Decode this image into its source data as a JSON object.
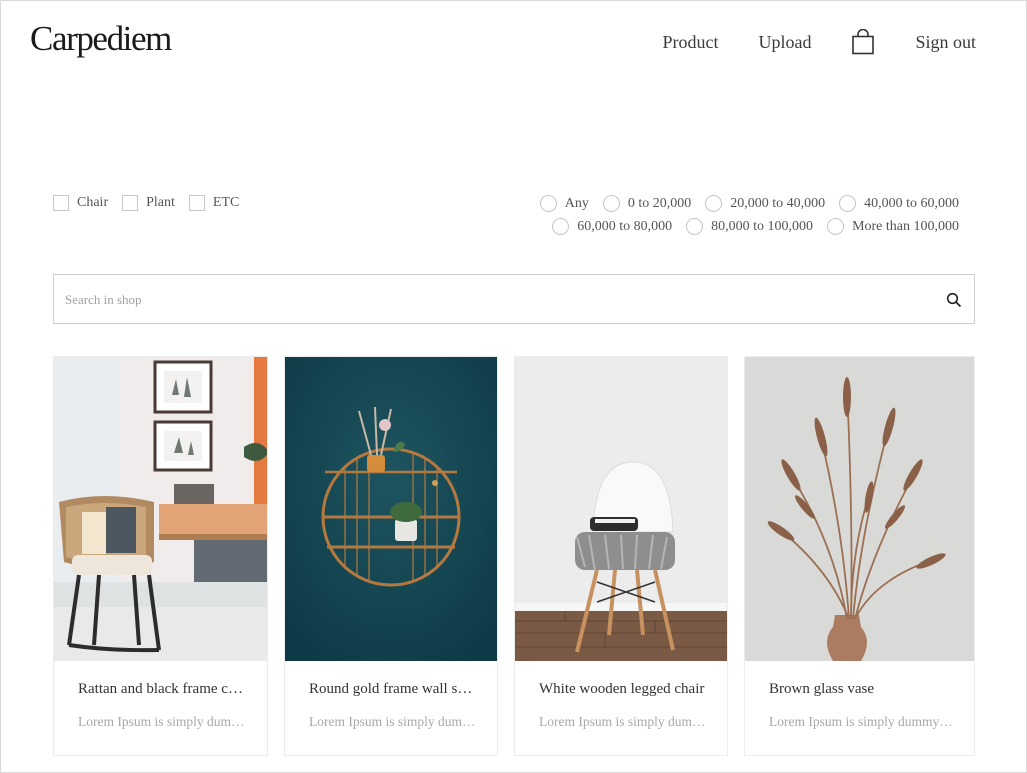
{
  "header": {
    "logo": "Carpediem",
    "nav": {
      "product": "Product",
      "upload": "Upload",
      "cart_icon": "shopping-bag-icon",
      "signout": "Sign out"
    }
  },
  "filters": {
    "categories": [
      "Chair",
      "Plant",
      "ETC"
    ],
    "prices_row1": [
      "Any",
      "0 to 20,000",
      "20,000 to 40,000",
      "40,000 to 60,000"
    ],
    "prices_row2": [
      "60,000 to 80,000",
      "80,000 to 100,000",
      "More than 100,000"
    ]
  },
  "search": {
    "placeholder": "Search in shop",
    "icon": "search-icon"
  },
  "products": [
    {
      "title": "Rattan and black frame chair",
      "description": "Lorem Ipsum is simply dummy text"
    },
    {
      "title": "Round gold frame wall shelf",
      "description": "Lorem Ipsum is simply dummy text"
    },
    {
      "title": "White wooden legged chair",
      "description": "Lorem Ipsum is simply dummy text"
    },
    {
      "title": "Brown glass vase",
      "description": "Lorem Ipsum is simply dummy text"
    }
  ]
}
